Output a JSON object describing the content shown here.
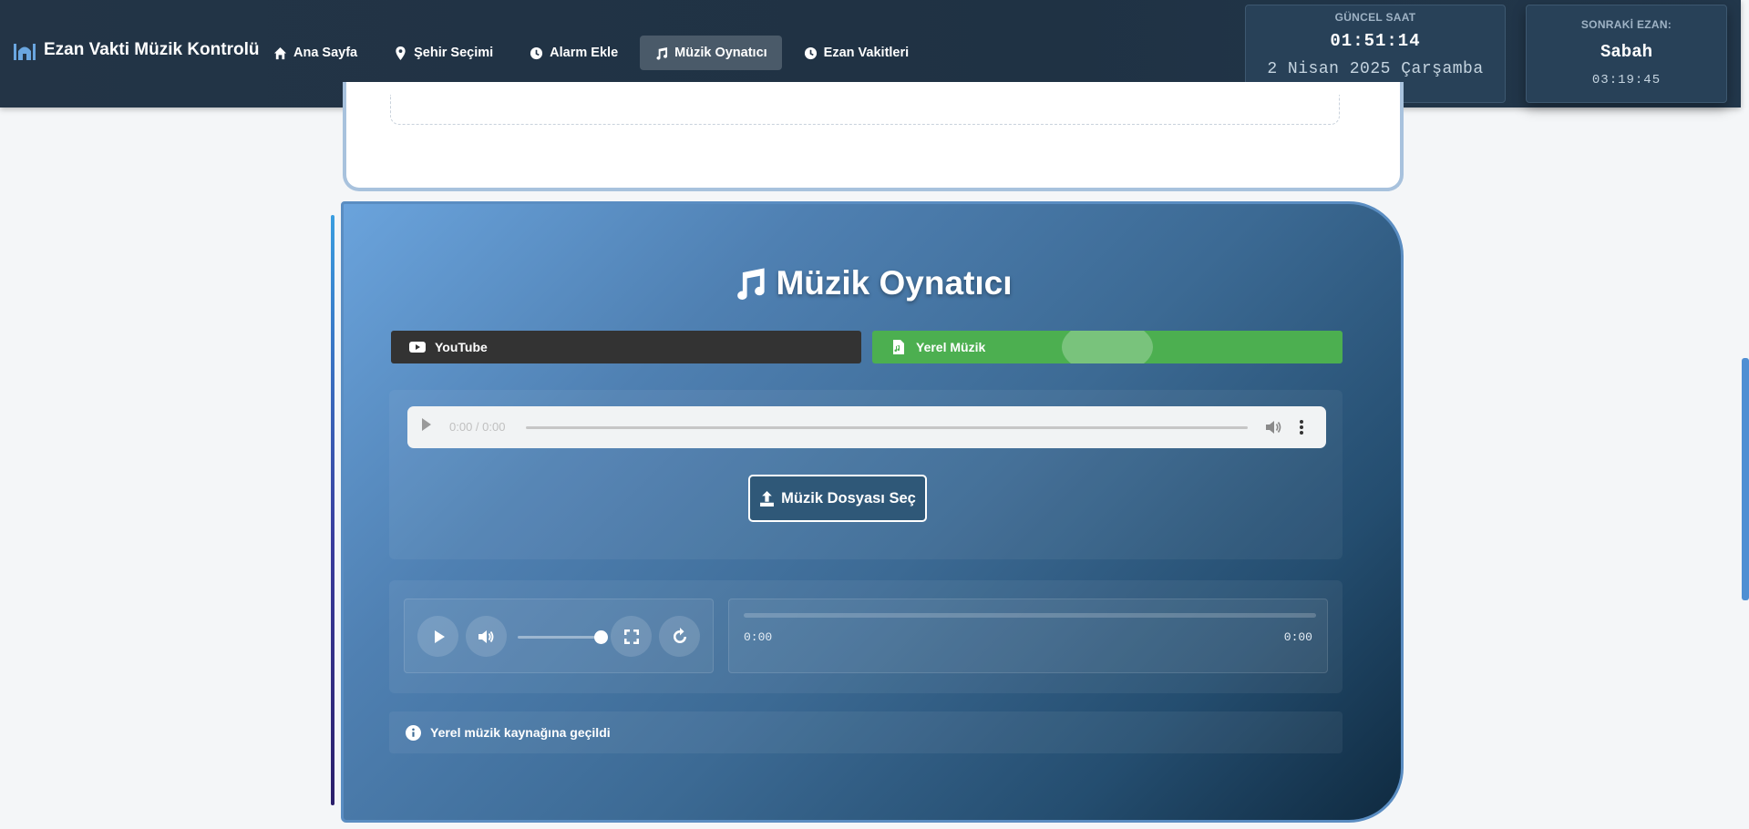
{
  "brand": {
    "title": "Ezan Vakti Müzik Kontrolü",
    "icon": "mosque-icon"
  },
  "nav": [
    {
      "label": "Ana Sayfa",
      "icon": "home-icon",
      "active": false
    },
    {
      "label": "Şehir Seçimi",
      "icon": "map-pin-icon",
      "active": false
    },
    {
      "label": "Alarm Ekle",
      "icon": "clock-icon",
      "active": false
    },
    {
      "label": "Müzik Oynatıcı",
      "icon": "music-icon",
      "active": true
    },
    {
      "label": "Ezan Vakitleri",
      "icon": "clock-icon",
      "active": false
    }
  ],
  "current_clock": {
    "label": "GÜNCEL SAAT",
    "time": "01:51:14",
    "date": "2 Nisan 2025 Çarşamba"
  },
  "next_prayer": {
    "label": "SONRAKİ EZAN:",
    "name": "Sabah",
    "countdown": "03:19:45"
  },
  "player": {
    "title": "Müzik Oynatıcı",
    "tabs": [
      {
        "label": "YouTube",
        "icon": "youtube-icon",
        "active": false
      },
      {
        "label": "Yerel Müzik",
        "icon": "file-audio-icon",
        "active": true
      }
    ],
    "audio": {
      "time": "0:00 / 0:00"
    },
    "file_button": "Müzik Dosyası Seç",
    "controls": {
      "volume": 1.0
    },
    "progress": {
      "current": "0:00",
      "duration": "0:00",
      "value": 0
    },
    "status": "Yerel müzik kaynağına geçildi"
  },
  "colors": {
    "nav_bg": "#233446",
    "active_tab": "#4caf50",
    "youtube_tab": "#333333",
    "accent": "#4f8fd3"
  }
}
